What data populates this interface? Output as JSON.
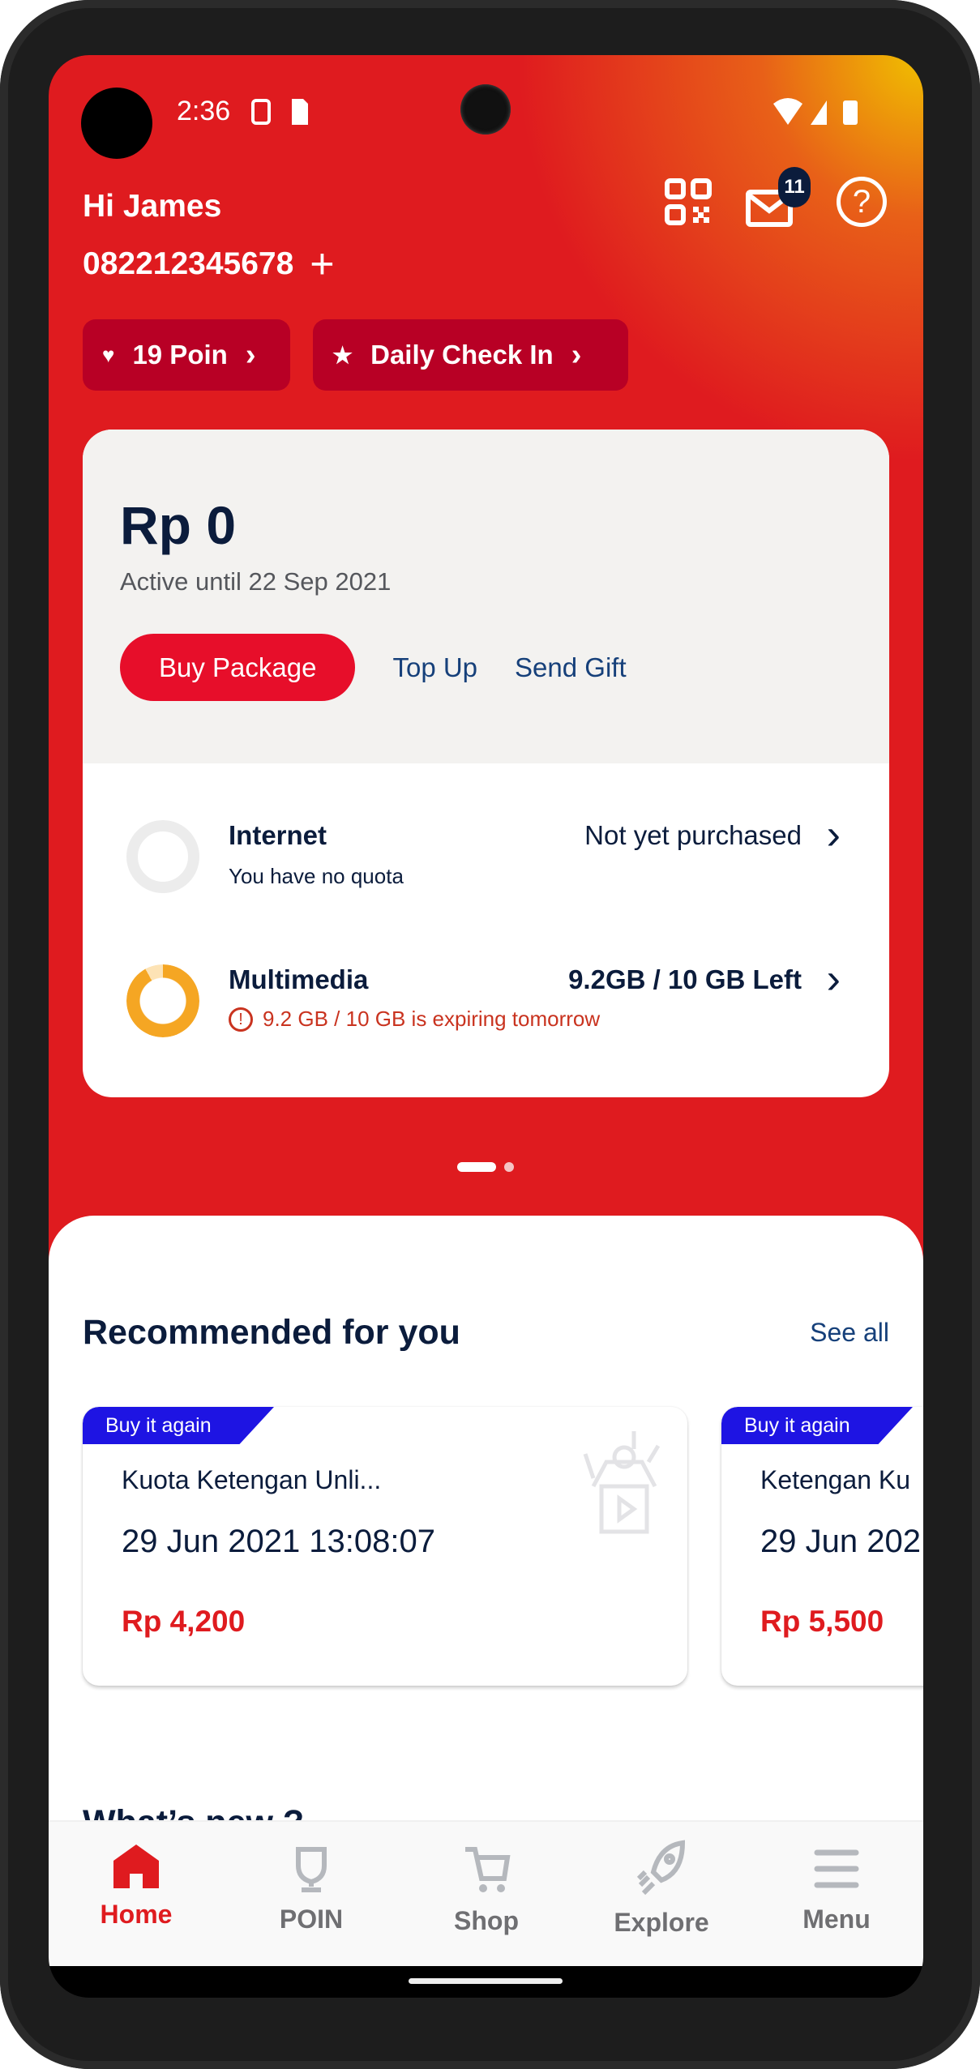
{
  "status_bar": {
    "time": "2:36"
  },
  "header": {
    "greeting": "Hi James",
    "phone_number": "082212345678",
    "notification_count": "11",
    "points_label": "19 Poin",
    "daily_check_in_label": "Daily Check In"
  },
  "balance_card": {
    "balance": "Rp 0",
    "active_until": "Active until 22 Sep 2021",
    "buy_package": "Buy Package",
    "top_up": "Top Up",
    "send_gift": "Send Gift",
    "quotas": [
      {
        "name": "Internet",
        "subtitle": "You have no quota",
        "status": "Not yet purchased",
        "fill": 0
      },
      {
        "name": "Multimedia",
        "subtitle": "9.2 GB / 10 GB is expiring tomorrow",
        "status": "9.2GB / 10 GB Left",
        "fill": 0.92
      }
    ]
  },
  "carousel": {
    "pages": 2,
    "active": 1
  },
  "recommended": {
    "title": "Recommended for you",
    "see_all": "See all",
    "items": [
      {
        "tag": "Buy it again",
        "name": "Kuota Ketengan Unli...",
        "date": "29 Jun 2021 13:08:07",
        "price": "Rp 4,200"
      },
      {
        "tag": "Buy it again",
        "name": "Ketengan Ku",
        "date": "29 Jun 202",
        "price": "Rp 5,500"
      }
    ]
  },
  "whats_new": {
    "title": "What’s new ?"
  },
  "bottom_nav": [
    {
      "label": "Home",
      "active": true
    },
    {
      "label": "POIN"
    },
    {
      "label": "Shop"
    },
    {
      "label": "Explore"
    },
    {
      "label": "Menu"
    }
  ],
  "colors": {
    "brand_red": "#df1b1f",
    "navy": "#0b1c3c",
    "tag_blue": "#1e14e3",
    "warning": "#c9331f",
    "orange": "#f5a623"
  }
}
